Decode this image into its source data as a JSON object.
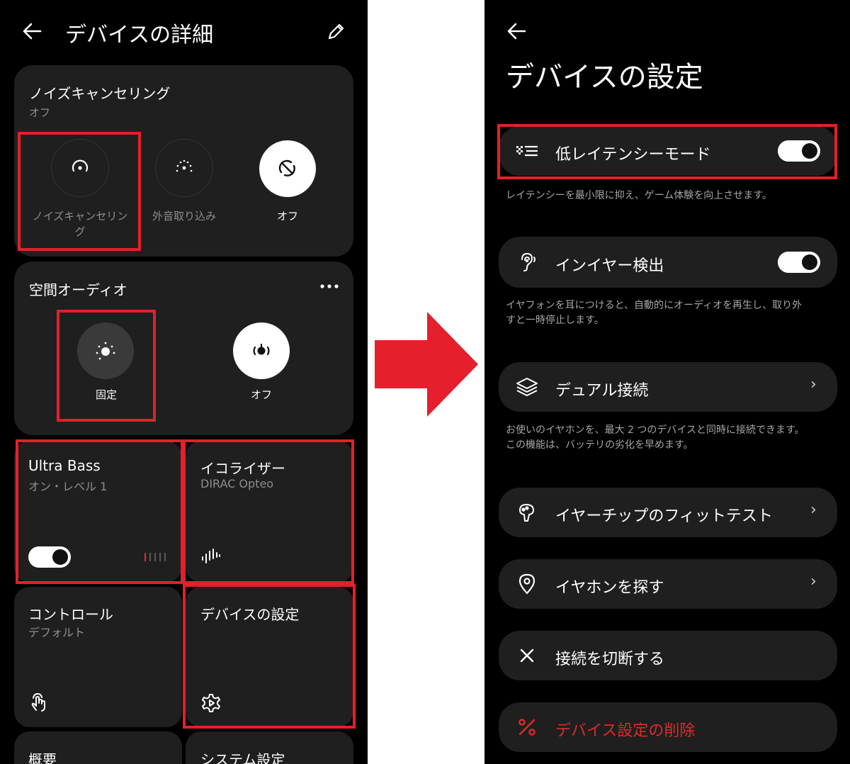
{
  "left": {
    "header": {
      "back_icon": "arrow-left-icon",
      "title": "デバイスの詳細",
      "edit_icon": "pencil-icon"
    },
    "noise_card": {
      "title": "ノイズキャンセリング",
      "subtitle": "オフ",
      "options": [
        {
          "label": "ノイズキャンセリング",
          "icon": "noise-cancel-icon"
        },
        {
          "label": "外音取り込み",
          "icon": "ambient-icon"
        },
        {
          "label": "オフ",
          "icon": "off-icon"
        }
      ]
    },
    "spatial_card": {
      "title": "空間オーディオ",
      "more_icon": "more-horizontal-icon",
      "options": [
        {
          "label": "固定",
          "icon": "fixed-spatial-icon"
        },
        {
          "label": "オフ",
          "icon": "spatial-off-icon"
        }
      ]
    },
    "tiles": {
      "ultra_bass": {
        "title": "Ultra Bass",
        "subtitle": "オン・レベル 1",
        "toggle_on": true,
        "level": 1,
        "level_max": 5
      },
      "equalizer": {
        "title": "イコライザー",
        "subtitle": "DIRAC Opteo",
        "icon": "equalizer-icon"
      },
      "control": {
        "title": "コントロール",
        "subtitle": "デフォルト",
        "icon": "tap-gesture-icon"
      },
      "device_settings": {
        "title": "デバイスの設定",
        "icon": "gear-icon"
      },
      "overview": {
        "title": "概要"
      },
      "system": {
        "title": "システム設定"
      }
    }
  },
  "right": {
    "header": {
      "back_icon": "arrow-left-icon",
      "title": "デバイスの設定"
    },
    "rows": [
      {
        "label": "低レイテンシーモード",
        "icon": "low-latency-icon",
        "toggle_on": true,
        "description": "レイテンシーを最小限に抑え、ゲーム体験を向上させます。"
      },
      {
        "label": "インイヤー検出",
        "icon": "ear-detect-icon",
        "toggle_on": true,
        "description_line1": "イヤフォンを耳につけると、自動的にオーディオを再生し、取り外",
        "description_line2": "すと一時停止します。"
      },
      {
        "label": "デュアル接続",
        "icon": "dual-connect-icon",
        "chevron": "›",
        "description_line1": "お使いのイヤホンを、最大 2 つのデバイスと同時に接続できます。",
        "description_line2": "この機能は、バッテリの劣化を早めます。"
      },
      {
        "label": "イヤーチップのフィットテスト",
        "icon": "ear-tip-icon",
        "chevron": "›"
      },
      {
        "label": "イヤホンを探す",
        "icon": "location-pin-icon",
        "chevron": "›"
      },
      {
        "label": "接続を切断する",
        "icon": "close-icon"
      },
      {
        "label": "デバイス設定の削除",
        "icon": "percent-delete-icon"
      }
    ]
  },
  "colors": {
    "highlight": "#e51f2b",
    "arrow": "#e51f2b",
    "danger_text": "#e02a2a",
    "card": "#1f1f1f",
    "background": "#000000"
  }
}
